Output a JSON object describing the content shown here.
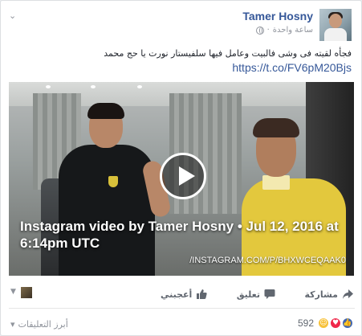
{
  "post": {
    "author": "Tamer Hosny",
    "timestamp": "ساعة واحدة",
    "privacy_icon": "globe-icon",
    "text": "فجأه لقيته فى وشى فالبيت وعامل فيها سلفيستار نورت يا حج محمد",
    "link": "https://t.co/FV6pM20Bjs"
  },
  "video": {
    "caption": "Instagram video by Tamer Hosny • Jul 12, 2016 at 6:14pm UTC",
    "source": "/INSTAGRAM.COM/P/BHXWCEQAAK0"
  },
  "actions": {
    "like": "أعجبني",
    "comment": "تعليق",
    "share": "مشاركة"
  },
  "reactions": {
    "count": "592",
    "types": [
      "like",
      "haha",
      "love"
    ]
  },
  "comments": {
    "sort_label": "أبرز التعليقات"
  },
  "colors": {
    "link": "#365899",
    "facebook_blue": "#4267b2"
  }
}
